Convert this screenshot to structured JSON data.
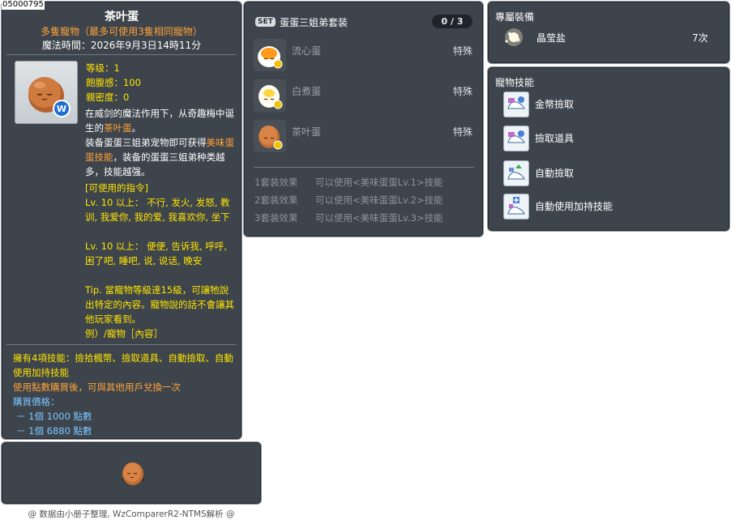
{
  "item_id": "05000795",
  "main": {
    "title": "茶叶蛋",
    "subtitle": "多隻寵物（最多可使用3隻相同寵物）",
    "magic_time": "魔法時間：2026年9月3日14時11分",
    "stats": {
      "level": "等级：1",
      "fullness": "飽腹感：100",
      "closeness": "親密度：0"
    },
    "desc_1_a": "在威剑的魔法作用下，从奇趣梅中诞生的",
    "desc_1_b": "茶叶蛋",
    "desc_1_c": "。",
    "desc_2_a": "装备蛋蛋三姐弟宠物即可获得",
    "desc_2_b": "美味蛋蛋技能",
    "desc_2_c": "，装备的蛋蛋三姐弟种类越多，技能越强。",
    "cmd_header": "[可使用的指令]",
    "lv10_a": "Lv. 10 以上： 不行, 发火, 发怒, 教训, 我爱你, 我的爱, 我喜欢你, 坐下",
    "lv10_b": "Lv. 10 以上： 便便, 告诉我, 呼呼, 困了吧, 睡吧, 说, 说话, 晚安",
    "tip": "Tip. 當寵物等級達15級，可讓牠說出特定的內容。寵物說的話不會讓其他玩家看到。",
    "example": "例）/寵物［內容］",
    "skills_line": "擁有4項技能：撿拾楓幣、撿取道具、自動撿取、自動使用加持技能",
    "trade_line": "使用點數購買後，可與其他用戶兌換一次",
    "price_label": "購買價格：",
    "price_1": "－ 1個  1000 點數",
    "price_2": "－ 1個  6880 點數"
  },
  "set": {
    "badge": "SET",
    "title": "蛋蛋三姐弟套装",
    "count": "0 / 3",
    "items": [
      {
        "name": "流心蛋",
        "type": "特殊"
      },
      {
        "name": "白煮蛋",
        "type": "特殊"
      },
      {
        "name": "茶叶蛋",
        "type": "特殊"
      }
    ],
    "effects": [
      {
        "label": "1套装效果",
        "text": "可以使用<美味蛋蛋Lv.1>技能"
      },
      {
        "label": "2套装效果",
        "text": "可以使用<美味蛋蛋Lv.2>技能"
      },
      {
        "label": "3套装效果",
        "text": "可以使用<美味蛋蛋Lv.3>技能"
      }
    ]
  },
  "exclusive": {
    "header": "專屬裝備",
    "item_name": "晶莹盐",
    "item_count": "7次"
  },
  "pet_skills": {
    "header": "寵物技能",
    "items": [
      "金幣撿取",
      "撿取道具",
      "自動撿取",
      "自動使用加持技能"
    ]
  },
  "footer": "@ 数据由小册子整理, WzComparerR2-NTMS解析 @",
  "colors": {
    "panel_bg": "#373e46",
    "orange": "#ffa238",
    "yellow": "#ffe400",
    "blue": "#7cc6ff"
  }
}
